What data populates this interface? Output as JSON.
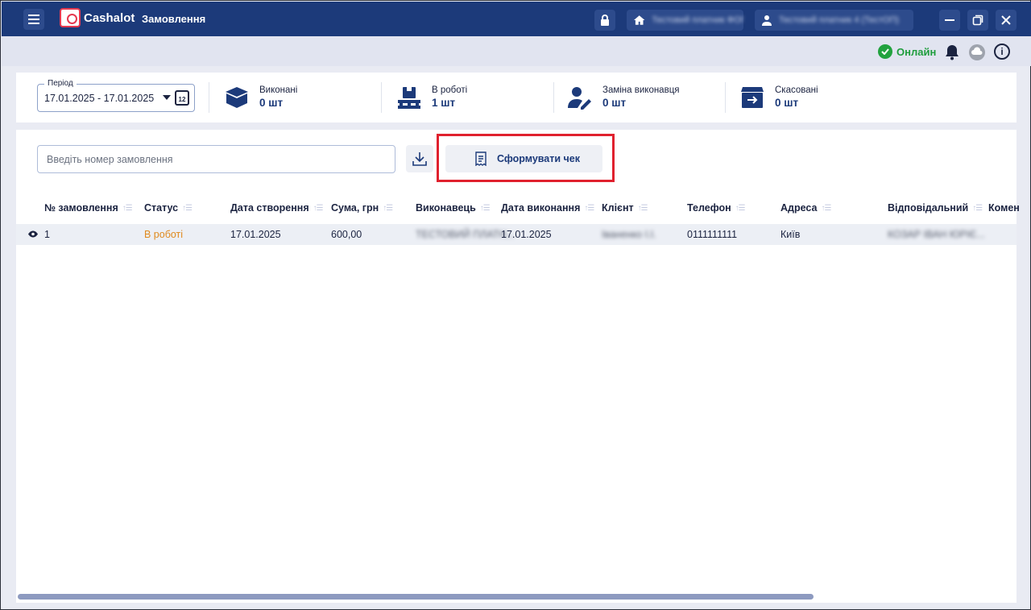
{
  "header": {
    "logo_text": "Cashalot",
    "page_title": "Замовлення",
    "company_name": "Тестовий платник ФОП",
    "user_name": "Тестовий платник 4 (ТестОП)"
  },
  "status": {
    "online_label": "Онлайн",
    "info_label": "i"
  },
  "period": {
    "label": "Період",
    "value": "17.01.2025 - 17.01.2025",
    "cal_day": "12"
  },
  "stats": [
    {
      "label": "Виконані",
      "value": "0 шт"
    },
    {
      "label": "В роботі",
      "value": "1 шт"
    },
    {
      "label": "Заміна виконавця",
      "value": "0 шт"
    },
    {
      "label": "Скасовані",
      "value": "0 шт"
    }
  ],
  "toolbar": {
    "search_placeholder": "Введіть номер замовлення",
    "receipt_button": "Сформувати чек"
  },
  "table": {
    "columns": [
      "№ замовлення",
      "Статус",
      "Дата створення",
      "Сума, грн",
      "Виконавець",
      "Дата виконання",
      "Клієнт",
      "Телефон",
      "Адреса",
      "Відповідальний",
      "Комен"
    ],
    "rows": [
      {
        "number": "1",
        "status": "В роботі",
        "created": "17.01.2025",
        "sum": "600,00",
        "executor": "ТЕСТОВИЙ ПЛАТН...",
        "done": "17.01.2025",
        "client": "Іваненко І.І.",
        "phone": "0111111111",
        "address": "Київ",
        "responsible": "КОЗАР ІВАН ЮРІЄ..."
      }
    ]
  },
  "colors": {
    "header_bg": "#1c3a7a",
    "accent": "#1c3a7a",
    "status_in_progress": "#e08a1e",
    "online": "#22a23f",
    "highlight": "#e0212e"
  }
}
